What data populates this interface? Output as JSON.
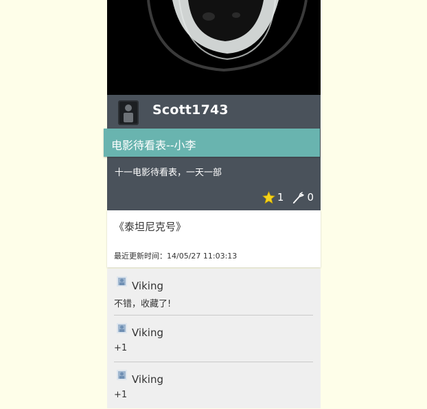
{
  "user": {
    "name": "Scott1743"
  },
  "list": {
    "title": "电影待看表--小李",
    "description": "十一电影待看表，一天一部",
    "stars": "1",
    "forks": "0"
  },
  "entry": {
    "movie": "《泰坦尼克号》",
    "updated": "最近更新时间：14/05/27 11:03:13"
  },
  "comments": [
    {
      "author": "Viking",
      "text": "不错，收藏了!"
    },
    {
      "author": "Viking",
      "text": "+1"
    },
    {
      "author": "Viking",
      "text": "+1"
    }
  ],
  "icons": {
    "star": "star-icon",
    "fork": "fork-icon",
    "avatar": "avatar-icon"
  },
  "colors": {
    "background": "#fefee9",
    "userbar": "#4a525b",
    "ribbon": "#69b4af",
    "comments_bg": "#efefef"
  }
}
